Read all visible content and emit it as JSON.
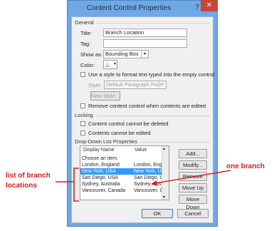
{
  "dialog": {
    "title": "Content Control Properties",
    "help_glyph": "?",
    "close_glyph": "✕"
  },
  "general": {
    "heading": "General",
    "title_label": "Title:",
    "title_value": "Branch Location",
    "tag_label": "Tag:",
    "tag_value": "",
    "show_as_label": "Show as:",
    "show_as_value": "Bounding Box",
    "color_label": "Color:",
    "use_style_label": "Use a style to format text typed into the empty control",
    "style_label": "Style:",
    "style_value": "Default Paragraph Font",
    "new_style_label": "New Style...",
    "remove_when_edited_label": "Remove content control when contents are edited"
  },
  "locking": {
    "heading": "Locking",
    "cannot_delete_label": "Content control cannot be deleted",
    "cannot_edit_label": "Contents cannot be edited"
  },
  "dropdown": {
    "heading": "Drop-Down List Properties",
    "col_display": "Display Name",
    "col_value": "Value",
    "items": [
      {
        "display": "Choose an item.",
        "value": ""
      },
      {
        "display": "London, England",
        "value": "London, Engl"
      },
      {
        "display": "New York, USA",
        "value": "New York, US"
      },
      {
        "display": "San Diego, USA",
        "value": "San Diego, US"
      },
      {
        "display": "Sydney, Australia",
        "value": "Sydney, Austr"
      },
      {
        "display": "Vancouver, Canada",
        "value": "Vancouver, Ca"
      }
    ],
    "selected_index": 2,
    "buttons": {
      "add": "Add...",
      "modify": "Modify...",
      "remove": "Remove",
      "move_up": "Move Up",
      "move_down": "Move Down"
    }
  },
  "footer": {
    "ok": "OK",
    "cancel": "Cancel"
  },
  "annotations": {
    "list_label_line1": "list of branch",
    "list_label_line2": "locations",
    "one_branch": "one branch",
    "color": "#d21f1f"
  }
}
